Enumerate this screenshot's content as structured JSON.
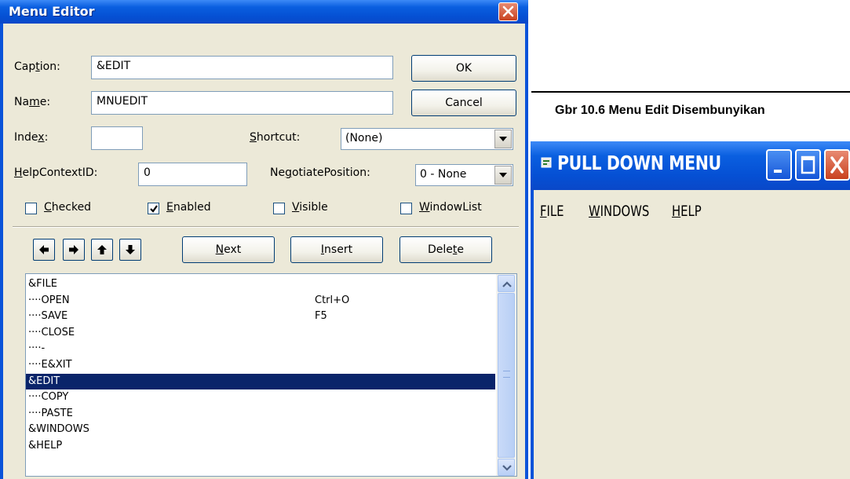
{
  "menu_editor": {
    "title": "Menu Editor",
    "caption_label_pre": "Cap",
    "caption_label_ul": "t",
    "caption_label_post": "ion:",
    "caption_value": "&EDIT",
    "name_label_pre": "Na",
    "name_label_ul": "m",
    "name_label_post": "e:",
    "name_value": "MNUEDIT",
    "index_label_pre": "Inde",
    "index_label_ul": "x",
    "index_label_post": ":",
    "index_value": "",
    "shortcut_label_ul": "S",
    "shortcut_label_post": "hortcut:",
    "shortcut_value": "(None)",
    "helpcontext_label_ul": "H",
    "helpcontext_label_post": "elpContextID:",
    "helpcontext_value": "0",
    "negotiate_label_pre": "Ne",
    "negotiate_label_ul": "g",
    "negotiate_label_post": "otiatePosition:",
    "negotiate_value": "0 - None",
    "ok_label": "OK",
    "cancel_label": "Cancel",
    "checked_label_ul": "C",
    "checked_label_post": "hecked",
    "checked_state": false,
    "enabled_label_ul": "E",
    "enabled_label_post": "nabled",
    "enabled_state": true,
    "visible_label_ul": "V",
    "visible_label_post": "isible",
    "visible_state": false,
    "windowlist_label_ul": "W",
    "windowlist_label_post": "indowList",
    "windowlist_state": false,
    "next_label_ul": "N",
    "next_label_post": "ext",
    "insert_label_ul": "I",
    "insert_label_post": "nsert",
    "delete_label_pre": "Dele",
    "delete_label_ul": "t",
    "delete_label_post": "e",
    "menu_items": [
      {
        "text": "&FILE",
        "shortcut": ""
      },
      {
        "text": "····OPEN",
        "shortcut": "Ctrl+O"
      },
      {
        "text": "····SAVE",
        "shortcut": "F5"
      },
      {
        "text": "····CLOSE",
        "shortcut": ""
      },
      {
        "text": "····-",
        "shortcut": ""
      },
      {
        "text": "····E&XIT",
        "shortcut": ""
      },
      {
        "text": "&EDIT",
        "shortcut": ""
      },
      {
        "text": "····COPY",
        "shortcut": ""
      },
      {
        "text": "····PASTE",
        "shortcut": ""
      },
      {
        "text": "&WINDOWS",
        "shortcut": ""
      },
      {
        "text": "&HELP",
        "shortcut": ""
      }
    ],
    "selected_index": 6
  },
  "figure_caption": "Gbr 10.6 Menu Edit Disembunyikan",
  "pull_down_window": {
    "title": "PULL DOWN MENU",
    "menus": [
      {
        "ul": "F",
        "rest": "ILE"
      },
      {
        "ul": "W",
        "rest": "INDOWS"
      },
      {
        "ul": "H",
        "rest": "ELP"
      }
    ]
  },
  "colors": {
    "title_blue": "#0a53d9",
    "selection": "#0a246a",
    "dialog_face": "#ece9d8",
    "close_red": "#c9421f"
  }
}
